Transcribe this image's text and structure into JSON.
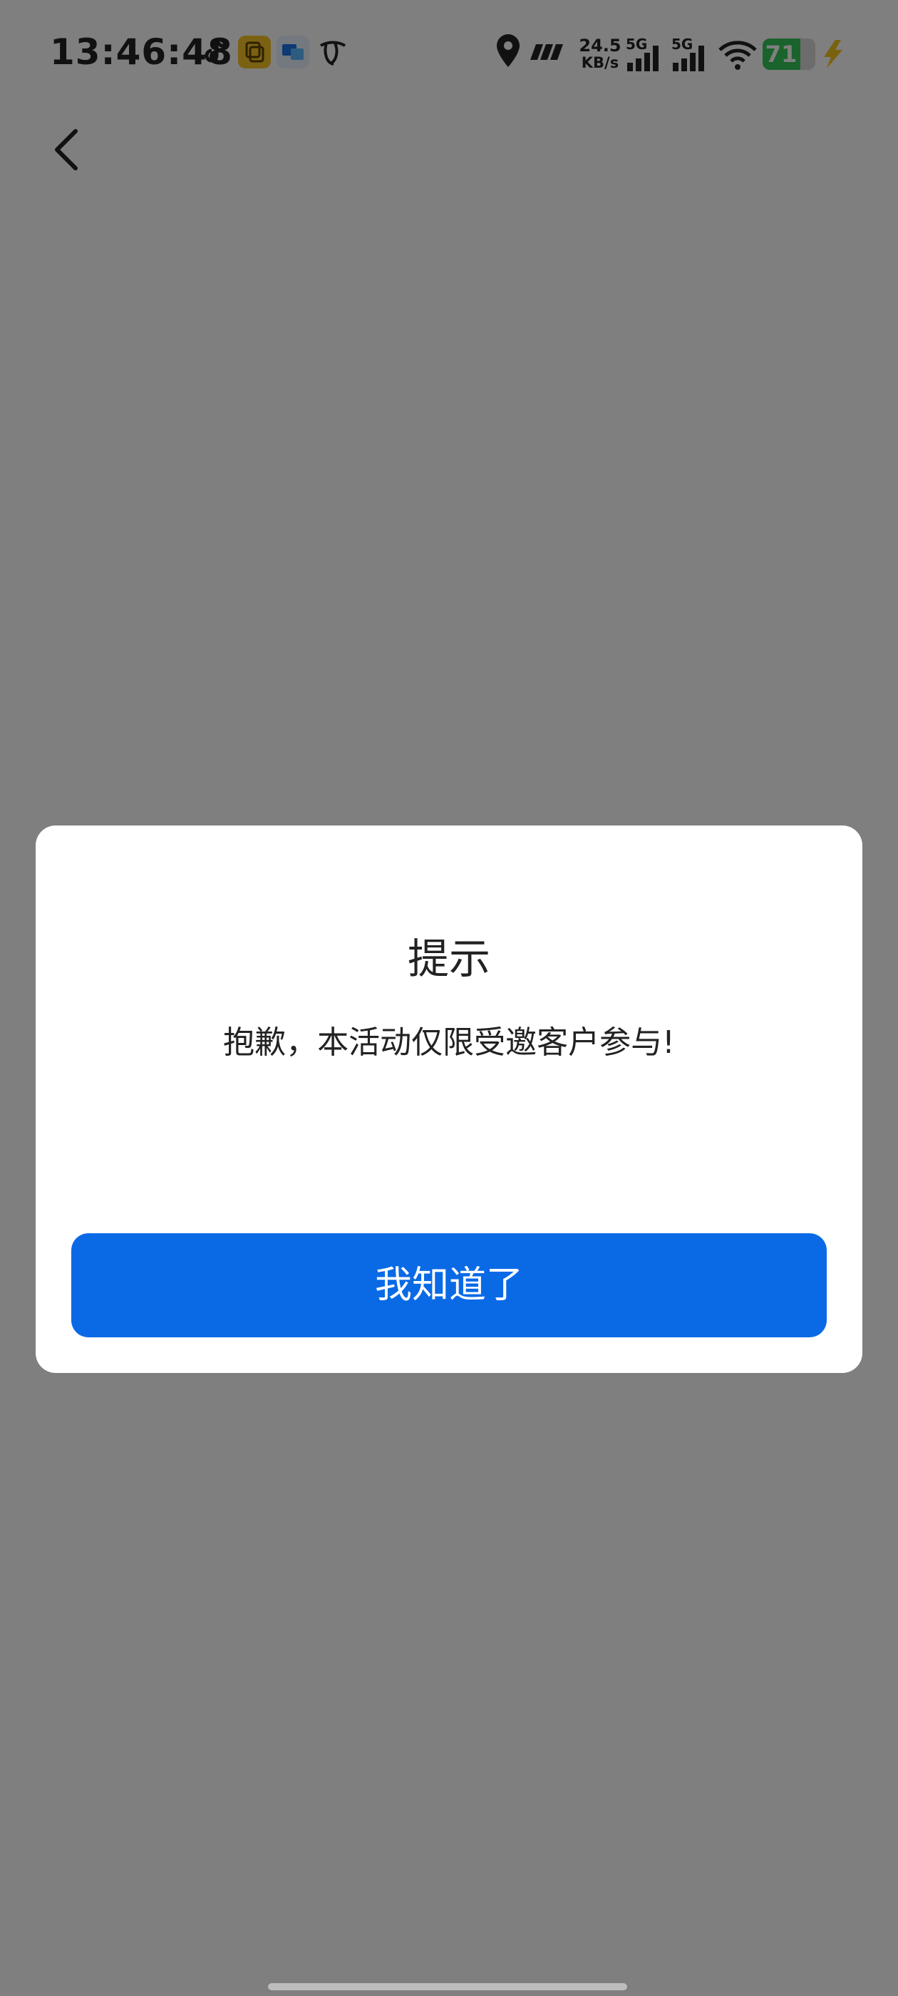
{
  "status_bar": {
    "time": "13:46:48",
    "net_speed_value": "24.5",
    "net_speed_unit": "KB/s",
    "sim1_label": "5G",
    "sim2_label": "5G",
    "battery_level": "71",
    "battery_fraction": 0.71,
    "icons": [
      "tiktok-icon",
      "yellow-app-icon",
      "blue-app-icon",
      "telecom-icon",
      "location-icon",
      "wave-icon",
      "signal-icon",
      "wifi-icon",
      "battery-icon",
      "charge-icon"
    ]
  },
  "nav": {
    "back_icon": "chevron-left-icon"
  },
  "dialog": {
    "title": "提示",
    "message": "抱歉，本活动仅限受邀客户参与!",
    "confirm_label": "我知道了"
  },
  "colors": {
    "primary": "#0a6ae6",
    "battery": "#34c759",
    "charge": "#f5c518",
    "overlay": "#7f7f7f"
  }
}
